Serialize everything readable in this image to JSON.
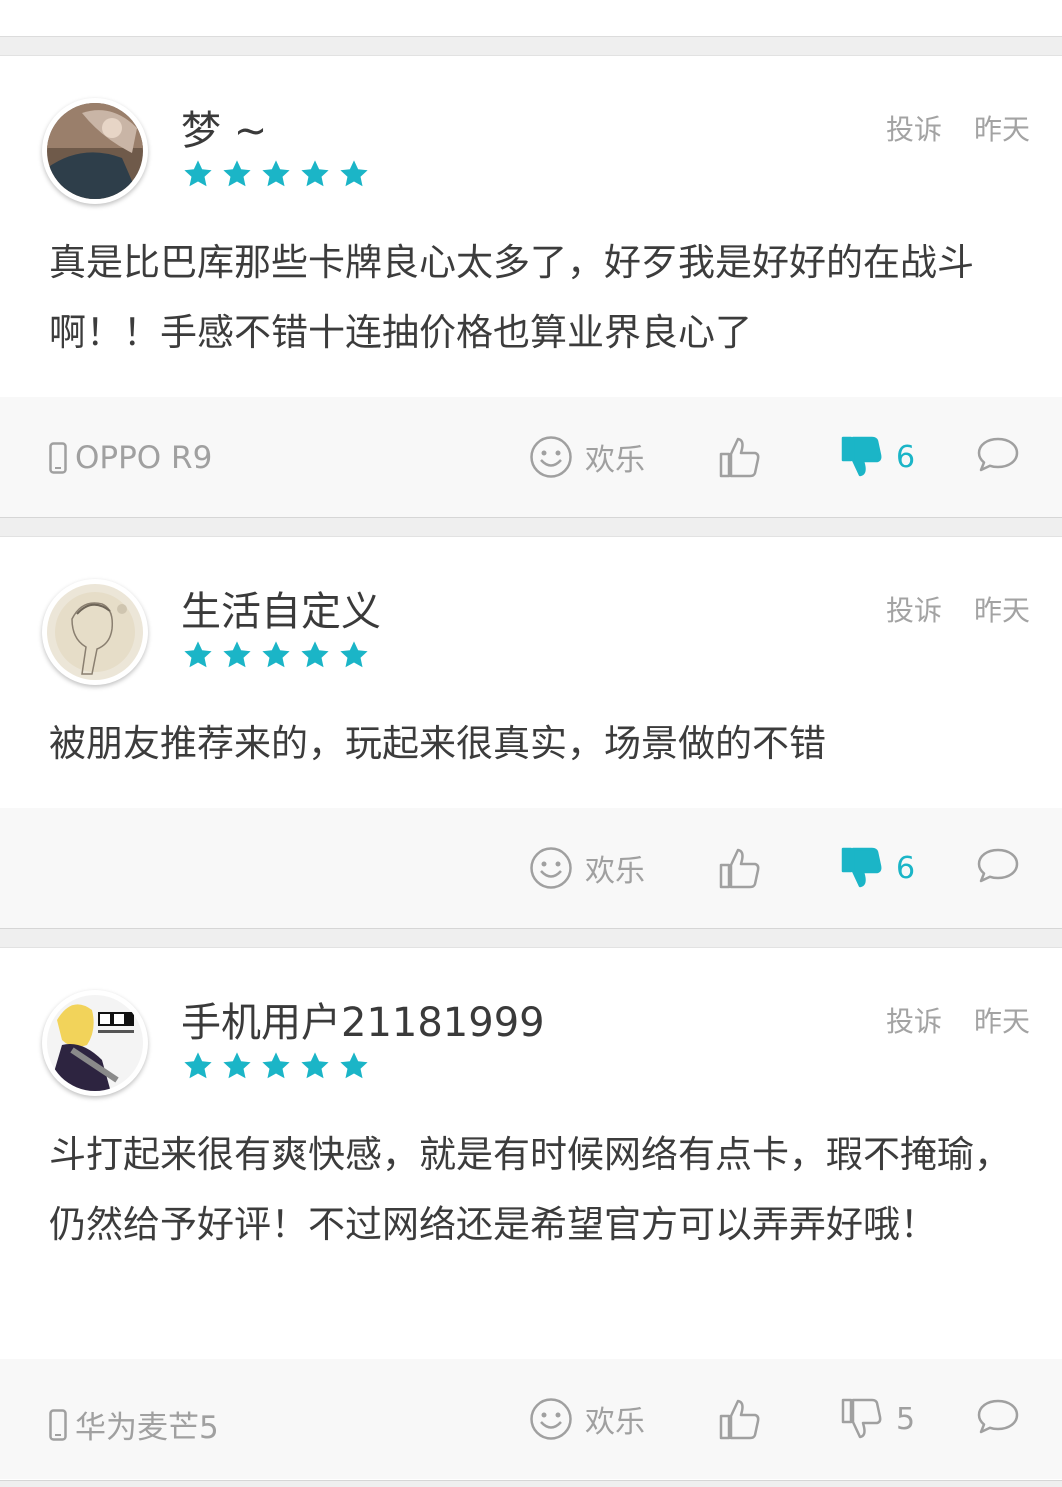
{
  "colors": {
    "accent": "#1bb5c7",
    "muted": "#a0a0a0",
    "text": "#3c3c3c"
  },
  "reviews": [
    {
      "username": "梦 ~",
      "rating": 5,
      "report_label": "投诉",
      "time": "昨天",
      "text": "真是比巴库那些卡牌良心太多了，好歹我是好好的在战斗啊！！手感不错十连抽价格也算业界良心了",
      "device": "OPPO R9",
      "fun_label": "欢乐",
      "dislike_count": "6",
      "dislike_active": true
    },
    {
      "username": "生活自定义",
      "rating": 5,
      "report_label": "投诉",
      "time": "昨天",
      "text": "被朋友推荐来的，玩起来很真实，场景做的不错",
      "device": "",
      "fun_label": "欢乐",
      "dislike_count": "6",
      "dislike_active": true
    },
    {
      "username": "手机用户21181999",
      "rating": 5,
      "report_label": "投诉",
      "time": "昨天",
      "text": "斗打起来很有爽快感，就是有时候网络有点卡，瑕不掩瑜，仍然给予好评！不过网络还是希望官方可以弄弄好哦！",
      "device": "华为麦芒5",
      "fun_label": "欢乐",
      "dislike_count": "5",
      "dislike_active": false
    }
  ]
}
